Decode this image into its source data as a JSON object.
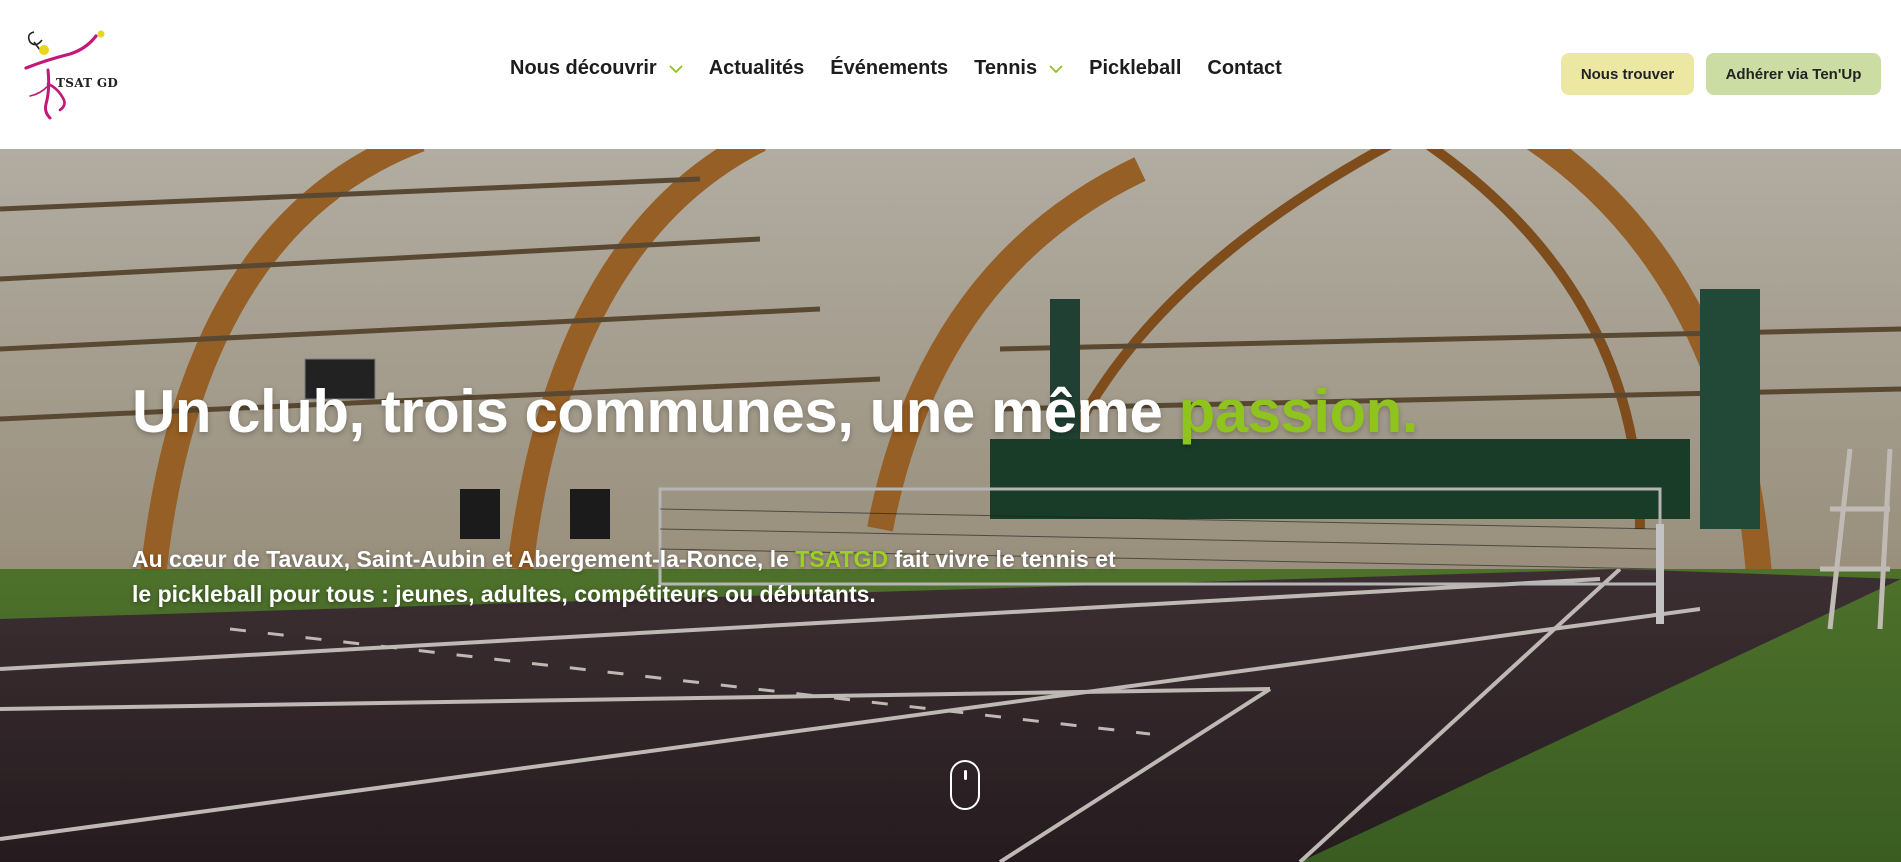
{
  "brand": {
    "logo_text": "TSAT GD",
    "accent_color": "#8fc41c",
    "logo_color": "#c2187a"
  },
  "nav": {
    "items": [
      {
        "label": "Nous découvrir",
        "has_dropdown": true
      },
      {
        "label": "Actualités",
        "has_dropdown": false
      },
      {
        "label": "Événements",
        "has_dropdown": false
      },
      {
        "label": "Tennis",
        "has_dropdown": true
      },
      {
        "label": "Pickleball",
        "has_dropdown": false
      },
      {
        "label": "Contact",
        "has_dropdown": false
      }
    ]
  },
  "buttons": {
    "find_label": "Nous trouver",
    "join_label": "Adhérer via Ten'Up"
  },
  "hero": {
    "title_main": "Un club, trois communes, une même ",
    "title_accent": "passion.",
    "subtitle_before": "Au cœur de Tavaux, Saint-Aubin et Abergement-la-Ronce, le ",
    "subtitle_accent": "TSATGD",
    "subtitle_after": " fait vivre le tennis et le pickleball pour tous : jeunes, adultes, compétiteurs ou débutants.",
    "scroll_icon": "mouse-scroll-icon"
  }
}
